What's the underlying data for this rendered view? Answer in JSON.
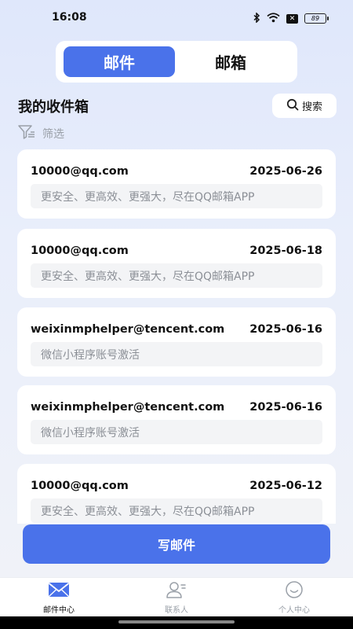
{
  "status_bar": {
    "time": "16:08",
    "battery": "89"
  },
  "segment": {
    "active_label": "邮件",
    "inactive_label": "邮箱"
  },
  "inbox": {
    "title": "我的收件箱",
    "search_label": "搜索",
    "filter_label": "筛选"
  },
  "mails": [
    {
      "from": "10000@qq.com",
      "date": "2025-06-26",
      "preview": "更安全、更高效、更强大，尽在QQ邮箱APP"
    },
    {
      "from": "10000@qq.com",
      "date": "2025-06-18",
      "preview": "更安全、更高效、更强大，尽在QQ邮箱APP"
    },
    {
      "from": "weixinmphelper@tencent.com",
      "date": "2025-06-16",
      "preview": "微信小程序账号激活"
    },
    {
      "from": "weixinmphelper@tencent.com",
      "date": "2025-06-16",
      "preview": "微信小程序账号激活"
    },
    {
      "from": "10000@qq.com",
      "date": "2025-06-12",
      "preview": "更安全、更高效、更强大，尽在QQ邮箱APP"
    }
  ],
  "compose_label": "写邮件",
  "tabbar": [
    {
      "label": "邮件中心",
      "icon": "mail-icon",
      "active": true
    },
    {
      "label": "联系人",
      "icon": "contacts-icon",
      "active": false
    },
    {
      "label": "个人中心",
      "icon": "profile-icon",
      "active": false
    }
  ],
  "colors": {
    "accent": "#4a72ea"
  }
}
